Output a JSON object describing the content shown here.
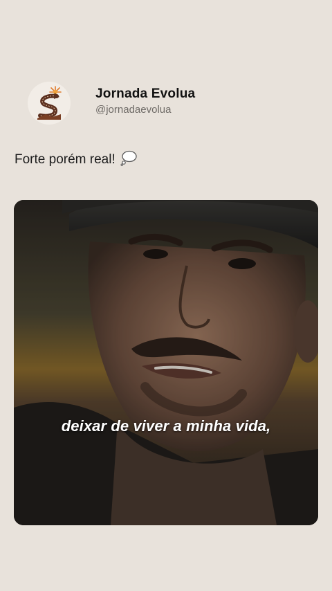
{
  "profile": {
    "display_name": "Jornada Evolua",
    "handle": "@jornadaevolua",
    "avatar_icon": "jornada-evolua-logo-icon"
  },
  "post": {
    "caption": "Forte porém real!",
    "caption_emoji_icon": "thought-bubble-icon"
  },
  "video": {
    "subtitle": "deixar de viver a minha vida,"
  },
  "colors": {
    "background": "#e8e2db",
    "logo_brown": "#5b2f1f",
    "logo_orange": "#e07a2a"
  }
}
